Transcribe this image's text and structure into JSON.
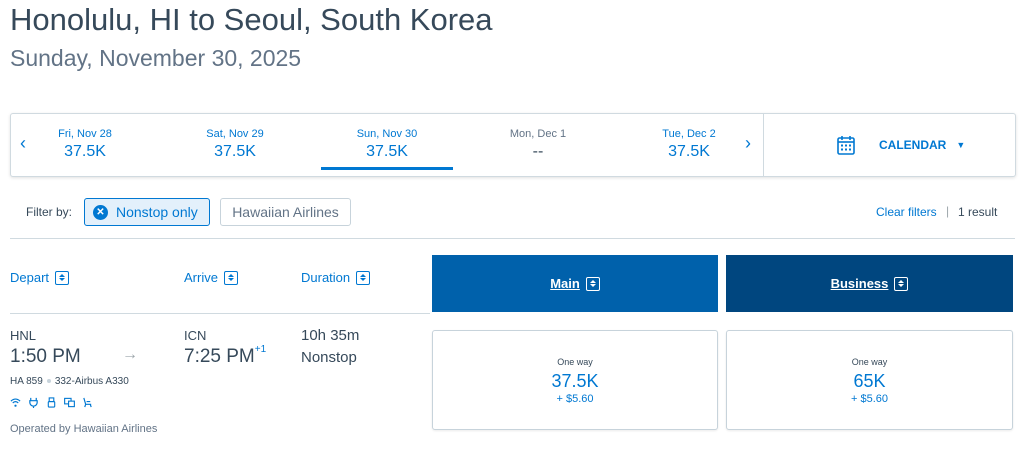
{
  "header": {
    "title": "Honolulu, HI to Seoul, South Korea",
    "subtitle": "Sunday, November 30, 2025"
  },
  "date_strip": {
    "prev_arrow": "‹",
    "next_arrow": "›",
    "dates": [
      {
        "label": "Fri, Nov 28",
        "value": "37.5K"
      },
      {
        "label": "Sat, Nov 29",
        "value": "37.5K"
      },
      {
        "label": "Sun, Nov 30",
        "value": "37.5K",
        "selected": true
      },
      {
        "label": "Mon, Dec 1",
        "value": "--"
      },
      {
        "label": "Tue, Dec 2",
        "value": "37.5K"
      }
    ],
    "calendar_label": "CALENDAR",
    "calendar_caret": "▼"
  },
  "filters": {
    "label": "Filter by:",
    "chips": [
      {
        "label": "Nonstop only",
        "active": true,
        "remove_glyph": "✕"
      },
      {
        "label": "Hawaiian Airlines",
        "active": false
      }
    ],
    "clear_label": "Clear filters",
    "separator": "|",
    "result_count": "1 result"
  },
  "columns": {
    "depart": "Depart",
    "arrive": "Arrive",
    "duration": "Duration",
    "main": "Main",
    "business": "Business"
  },
  "flight": {
    "depart_code": "HNL",
    "depart_time": "1:50 PM",
    "arrow": "→",
    "arrive_code": "ICN",
    "arrive_time": "7:25 PM",
    "arrive_day_offset": "+1",
    "flight_number": "HA 859",
    "aircraft": "332-Airbus A330",
    "duration": "10h 35m",
    "stops": "Nonstop",
    "operated_by": "Operated by Hawaiian Airlines",
    "amenities": [
      "wifi-icon",
      "power-plug-icon",
      "usb-icon",
      "entertainment-icon",
      "seat-icon"
    ],
    "fares": {
      "main": {
        "type": "One way",
        "miles": "37.5K",
        "tax": "+ $5.60"
      },
      "business": {
        "type": "One way",
        "miles": "65K",
        "tax": "+ $5.60"
      }
    }
  },
  "colors": {
    "accent": "#0078d2",
    "main_header": "#0061ab",
    "business_header": "#00467f",
    "text": "#36495a"
  }
}
